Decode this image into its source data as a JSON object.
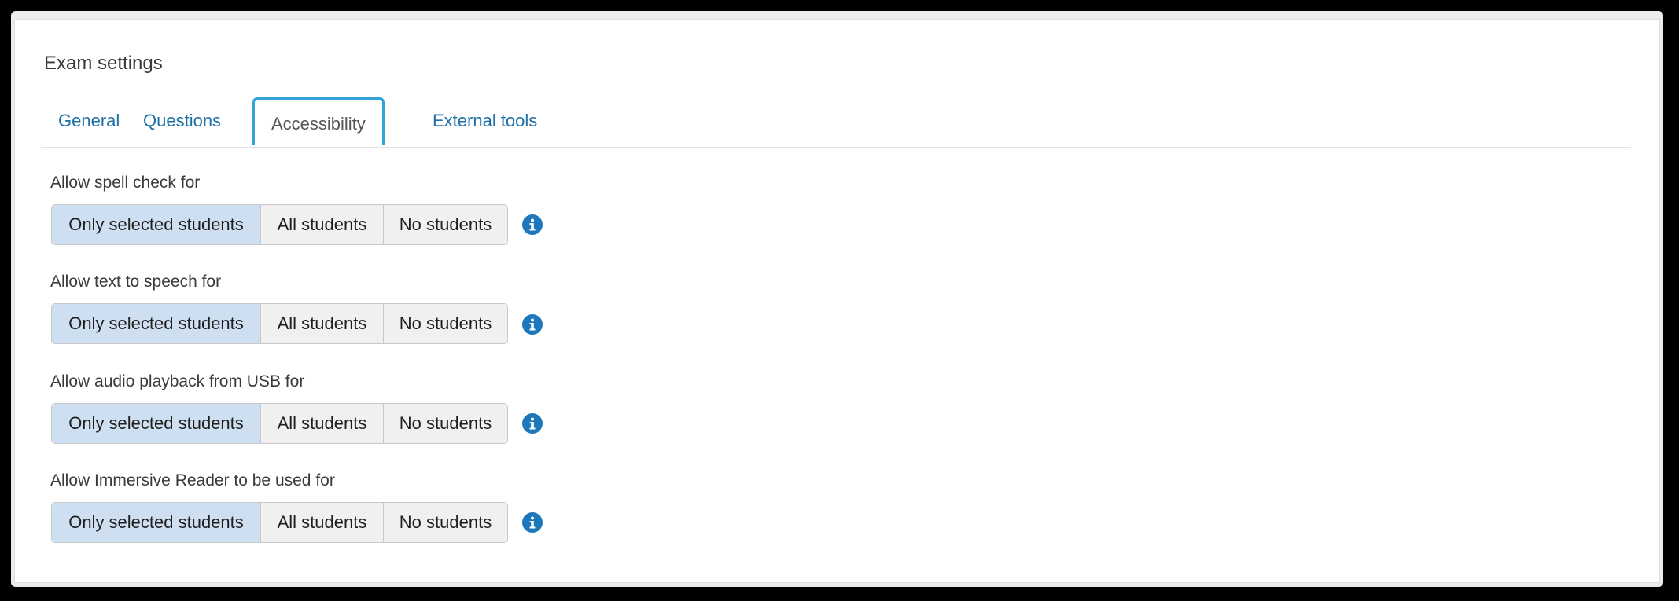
{
  "page": {
    "title": "Exam settings"
  },
  "tabs": [
    {
      "label": "General",
      "active": false
    },
    {
      "label": "Questions",
      "active": false
    },
    {
      "label": "Accessibility",
      "active": true
    },
    {
      "label": "External tools",
      "active": false
    }
  ],
  "settings": [
    {
      "label": "Allow spell check for",
      "options": [
        "Only selected students",
        "All students",
        "No students"
      ],
      "selected": "Only selected students",
      "icon": "info-icon"
    },
    {
      "label": "Allow text to speech for",
      "options": [
        "Only selected students",
        "All students",
        "No students"
      ],
      "selected": "Only selected students",
      "icon": "info-icon"
    },
    {
      "label": "Allow audio playback from USB for",
      "options": [
        "Only selected students",
        "All students",
        "No students"
      ],
      "selected": "Only selected students",
      "icon": "info-icon"
    },
    {
      "label": "Allow Immersive Reader to be used for",
      "options": [
        "Only selected students",
        "All students",
        "No students"
      ],
      "selected": "Only selected students",
      "icon": "info-icon"
    }
  ],
  "colors": {
    "link": "#1e6fa6",
    "active_tab_border": "#34a3dc",
    "selected_segment": "#cfdff2",
    "info_icon": "#1c77bb"
  }
}
